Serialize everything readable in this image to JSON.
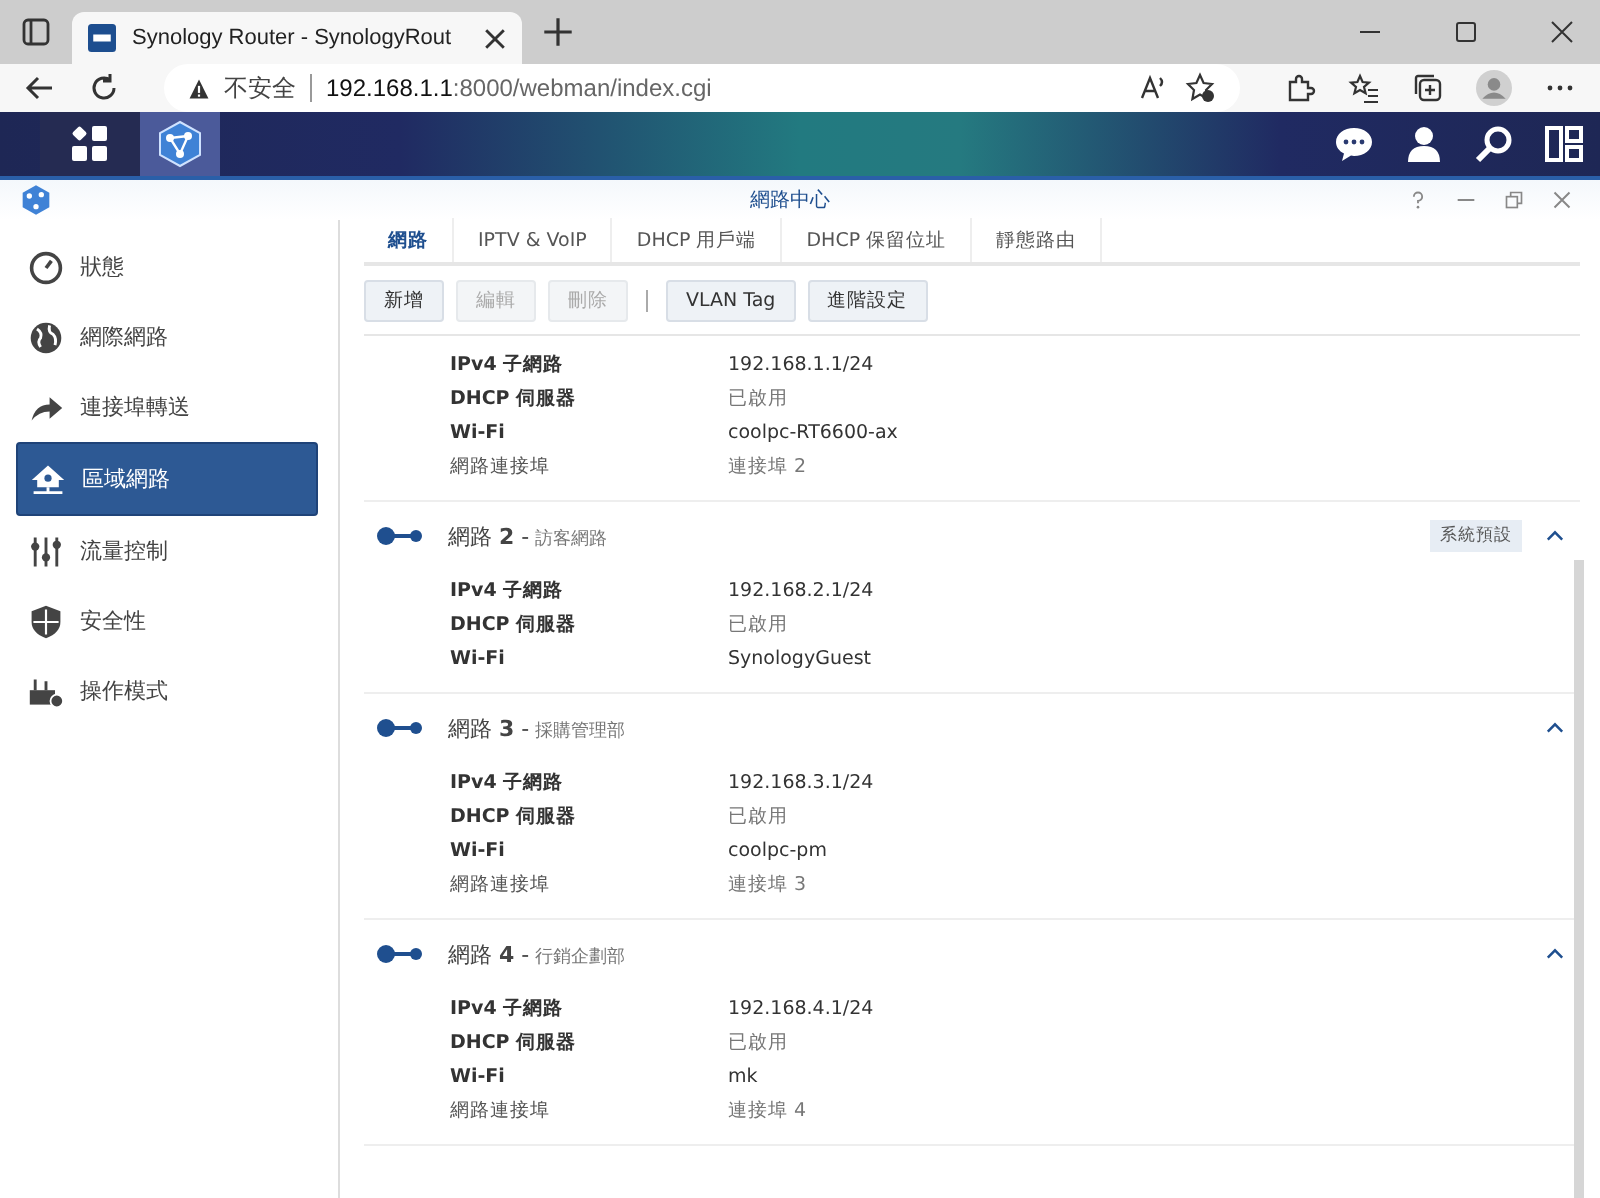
{
  "browser": {
    "tab_title": "Synology Router - SynologyRout",
    "security": "不安全",
    "url_host": "192.168.1.1",
    "url_path": ":8000/webman/index.cgi"
  },
  "window": {
    "title": "網路中心"
  },
  "sidebar": {
    "items": [
      {
        "label": "狀態",
        "selected": false
      },
      {
        "label": "網際網路",
        "selected": false
      },
      {
        "label": "連接埠轉送",
        "selected": false
      },
      {
        "label": "區域網路",
        "selected": true
      },
      {
        "label": "流量控制",
        "selected": false
      },
      {
        "label": "安全性",
        "selected": false
      },
      {
        "label": "操作模式",
        "selected": false
      }
    ]
  },
  "tabs": [
    {
      "label": "網路",
      "selected": true
    },
    {
      "label": "IPTV & VoIP",
      "selected": false
    },
    {
      "label": "DHCP 用戶端",
      "selected": false
    },
    {
      "label": "DHCP 保留位址",
      "selected": false
    },
    {
      "label": "靜態路由",
      "selected": false
    }
  ],
  "toolbar": [
    {
      "label": "新增",
      "disabled": false
    },
    {
      "label": "編輯",
      "disabled": true
    },
    {
      "label": "刪除",
      "disabled": true
    },
    {
      "kind": "separator"
    },
    {
      "label": "VLAN Tag",
      "disabled": false
    },
    {
      "label": "進階設定",
      "disabled": false
    }
  ],
  "networks": [
    {
      "rows": [
        {
          "kind": "subnet",
          "label": "IPv4 子網路",
          "value": "192.168.1.1/24"
        },
        {
          "kind": "dhcp",
          "label": "DHCP 伺服器",
          "value": "已啟用"
        },
        {
          "kind": "wifi",
          "label": "Wi-Fi",
          "value": "coolpc-RT6600-ax"
        },
        {
          "kind": "port",
          "label": "網路連接埠",
          "value": "連接埠 2"
        }
      ]
    },
    {
      "title": "網路 **2** -",
      "subtitle": "訪客網路",
      "badge": "系統預設",
      "expanded": true,
      "rows": [
        {
          "kind": "subnet",
          "label": "IPv4 子網路",
          "value": "192.168.2.1/24"
        },
        {
          "kind": "dhcp",
          "label": "DHCP 伺服器",
          "value": "已啟用"
        },
        {
          "kind": "wifi",
          "label": "Wi-Fi",
          "value": "SynologyGuest"
        }
      ]
    },
    {
      "title": "網路 **3** -",
      "subtitle": "採購管理部",
      "expanded": true,
      "rows": [
        {
          "kind": "subnet",
          "label": "IPv4 子網路",
          "value": "192.168.3.1/24"
        },
        {
          "kind": "dhcp",
          "label": "DHCP 伺服器",
          "value": "已啟用"
        },
        {
          "kind": "wifi",
          "label": "Wi-Fi",
          "value": "coolpc-pm"
        },
        {
          "kind": "port",
          "label": "網路連接埠",
          "value": "連接埠 3"
        }
      ]
    },
    {
      "title": "網路 **4** -",
      "subtitle": "行銷企劃部",
      "expanded": true,
      "rows": [
        {
          "kind": "subnet",
          "label": "IPv4 子網路",
          "value": "192.168.4.1/24"
        },
        {
          "kind": "dhcp",
          "label": "DHCP 伺服器",
          "value": "已啟用"
        },
        {
          "kind": "wifi",
          "label": "Wi-Fi",
          "value": "mk"
        },
        {
          "kind": "port",
          "label": "網路連接埠",
          "value": "連接埠 4"
        }
      ]
    }
  ]
}
